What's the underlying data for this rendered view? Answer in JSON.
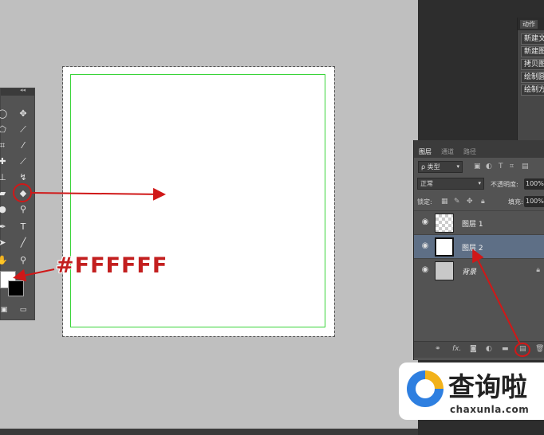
{
  "annotation": {
    "color_label": "#FFFFFF",
    "accent": "#d01818"
  },
  "canvas": {
    "frame_color": "#39d439",
    "fill_color": "#FFFFFF"
  },
  "toolbar": {
    "tools": [
      "lasso-icon",
      "move-icon",
      "polygon-lasso-icon",
      "quick-select-icon",
      "crop-icon",
      "eyedropper-icon",
      "healing-brush-icon",
      "brush-icon",
      "stamp-icon",
      "history-brush-icon",
      "eraser-icon",
      "paint-bucket-icon",
      "blur-icon",
      "dodge-icon",
      "pen-icon",
      "type-icon",
      "path-select-icon",
      "line-icon",
      "hand-icon",
      "zoom-icon"
    ],
    "foreground_color": "#FFFFFF",
    "background_color": "#000000"
  },
  "actions_panel": {
    "tab": "动作",
    "items": [
      "新建文",
      "新建图",
      "拷贝图",
      "绘制圆",
      "绘制方"
    ]
  },
  "layers_panel": {
    "tabs": [
      "图层",
      "通道",
      "路径"
    ],
    "filter_label": "ρ 类型",
    "blend_mode": "正常",
    "opacity_label": "不透明度:",
    "opacity_value": "100%",
    "lock_label": "锁定:",
    "fill_label": "填充:",
    "fill_value": "100%",
    "layers": [
      {
        "name": "图层 1",
        "selected": false
      },
      {
        "name": "图层 2",
        "selected": true
      },
      {
        "name": "背景",
        "selected": false,
        "locked": true
      }
    ],
    "footer_icons": [
      "link-icon",
      "fx-icon",
      "mask-icon",
      "adjustment-icon",
      "folder-icon",
      "new-layer-icon",
      "trash-icon"
    ],
    "footer_fx": "fx."
  },
  "watermark": {
    "cn": "查询啦",
    "en": "chaxunla.com"
  }
}
